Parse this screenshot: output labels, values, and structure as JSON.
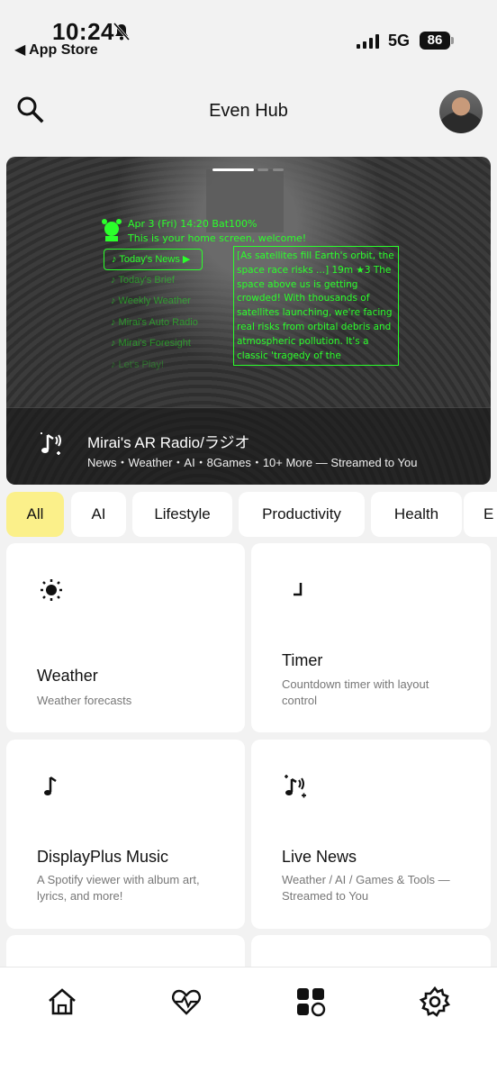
{
  "status_bar": {
    "time": "10:24",
    "back_label": "◀ App Store",
    "network": "5G",
    "battery": "86"
  },
  "header": {
    "title": "Even Hub"
  },
  "hero": {
    "hud_time": "Apr 3 (Fri) 14:20  Bat100%",
    "hud_welcome": "This is your home screen, welcome!",
    "menu": [
      "♪ Today's News ▶",
      "♪ Today's Brief",
      "♪ Weekly Weather",
      "♪ Mirai's Auto Radio",
      "♪ Mirai's Foresight",
      "♪ Let's Play!"
    ],
    "panel_text": "[As satellites fill Earth's orbit, the space race risks ...] 19m ★3 The space above us is getting crowded! With thousands of satellites launching, we're facing real risks from orbital debris and atmospheric pollution. It's a classic 'tragedy of the commons...",
    "title": "Mirai's AR Radio/ラジオ",
    "subtitle": "News・Weather・AI・8Games・10+ More — Streamed to You"
  },
  "chips": [
    "All",
    "AI",
    "Lifestyle",
    "Productivity",
    "Health",
    "E"
  ],
  "cards": [
    {
      "icon": "sun-icon",
      "title": "Weather",
      "desc": "Weather forecasts"
    },
    {
      "icon": "timer-icon",
      "title": "Timer",
      "desc": "Countdown timer with layout control"
    },
    {
      "icon": "music-note-icon",
      "title": "DisplayPlus Music",
      "desc": "A Spotify viewer with album art, lyrics, and more!"
    },
    {
      "icon": "radio-music-icon",
      "title": "Live News",
      "desc": "Weather / AI / Games & Tools — Streamed to You"
    }
  ],
  "bottom_nav": [
    "home-icon",
    "health-icon",
    "apps-icon",
    "settings-icon"
  ],
  "colors": {
    "accent_chip": "#fbf08a",
    "hud_green": "#2bff2b",
    "background": "#f2f2f2"
  }
}
